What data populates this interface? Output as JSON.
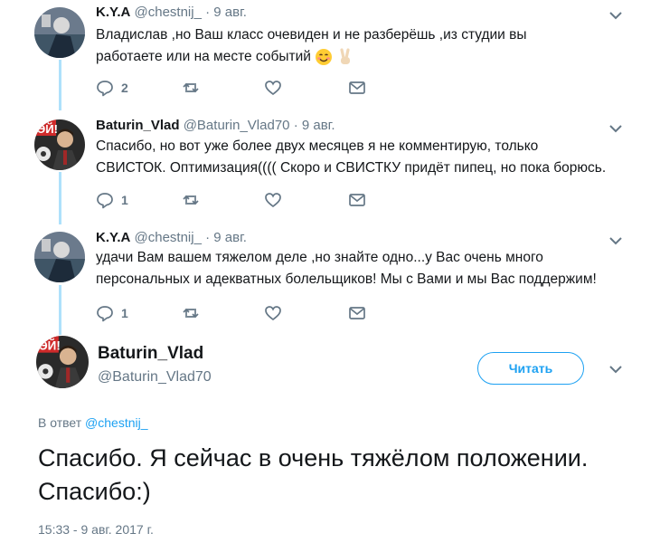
{
  "tweets": [
    {
      "name": "K.Y.A",
      "handle": "@chestnij_",
      "sep": "·",
      "date": "9 авг.",
      "line1": "Владислав ,но Ваш класс очевиден и не разберёшь ,из студии вы",
      "line2": "работаете или на месте событий",
      "emoji": [
        "smiling-face-emoji",
        "victory-hand-emoji"
      ],
      "reply_count": "2"
    },
    {
      "name": "Baturin_Vlad",
      "handle": "@Baturin_Vlad70",
      "sep": "·",
      "date": "9 авг.",
      "line1": "Спасибо, но вот уже более двух месяцев я не комментирую, только",
      "line2": "СВИСТОК. Оптимизация(((( Скоро и СВИСТКУ придёт пипец, но пока борюсь.",
      "reply_count": "1"
    },
    {
      "name": "K.Y.A",
      "handle": "@chestnij_",
      "sep": "·",
      "date": "9 авг.",
      "line1": "удачи Вам вашем тяжелом деле ,но знайте одно...у Вас очень много",
      "line2": "персональных и адекватных болельщиков! Мы с Вами и мы Вас поддержим!",
      "reply_count": "1"
    }
  ],
  "main": {
    "name": "Baturin_Vlad",
    "handle": "@Baturin_Vlad70",
    "follow_label": "Читать",
    "reply_prefix": "В ответ",
    "reply_to": "@chestnij_",
    "text": "Спасибо. Я сейчас в очень тяжёлом положении. Спасибо:)",
    "timestamp": "15:33 - 9 авг. 2017 г."
  },
  "colors": {
    "accent": "#1da1f2",
    "thread_line": "#aee1fb",
    "secondary_text": "#657786"
  }
}
